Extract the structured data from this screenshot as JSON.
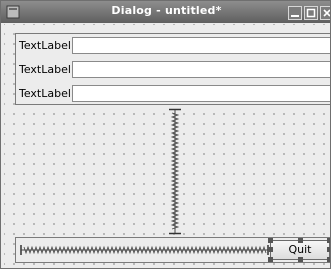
{
  "window": {
    "title": "Dialog - untitled*"
  },
  "form": {
    "rows": [
      {
        "label": "TextLabel",
        "value": ""
      },
      {
        "label": "TextLabel",
        "value": ""
      },
      {
        "label": "TextLabel",
        "value": ""
      }
    ]
  },
  "buttons": {
    "quit": "Quit"
  }
}
